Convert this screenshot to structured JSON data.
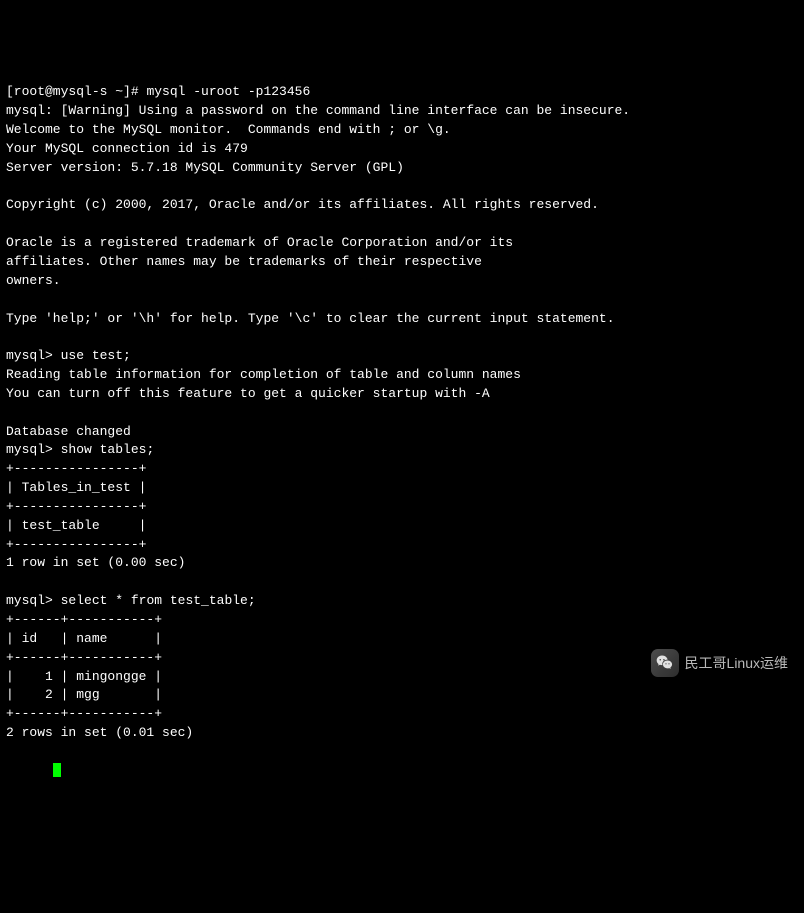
{
  "prompts": {
    "shell": "[root@mysql-s ~]#",
    "mysql": "mysql>"
  },
  "commands": {
    "login": "mysql -uroot -p123456",
    "use_db": "use test;",
    "show_tables": "show tables;",
    "select": "select * from test_table;"
  },
  "banner": {
    "warning": "mysql: [Warning] Using a password on the command line interface can be insecure.",
    "welcome": "Welcome to the MySQL monitor.  Commands end with ; or \\g.",
    "connection": "Your MySQL connection id is 479",
    "server": "Server version: 5.7.18 MySQL Community Server (GPL)",
    "copyright": "Copyright (c) 2000, 2017, Oracle and/or its affiliates. All rights reserved.",
    "trademark1": "Oracle is a registered trademark of Oracle Corporation and/or its",
    "trademark2": "affiliates. Other names may be trademarks of their respective",
    "trademark3": "owners.",
    "help": "Type 'help;' or '\\h' for help. Type '\\c' to clear the current input statement."
  },
  "use_db_output": {
    "line1": "Reading table information for completion of table and column names",
    "line2": "You can turn off this feature to get a quicker startup with -A",
    "changed": "Database changed"
  },
  "show_tables_result": {
    "sep": "+----------------+",
    "header": "| Tables_in_test |",
    "row1": "| test_table     |",
    "footer": "1 row in set (0.00 sec)"
  },
  "select_result": {
    "sep": "+------+-----------+",
    "header": "| id   | name      |",
    "row1": "|    1 | mingongge |",
    "row2": "|    2 | mgg       |",
    "footer": "2 rows in set (0.01 sec)"
  },
  "watermark": "民工哥Linux运维"
}
